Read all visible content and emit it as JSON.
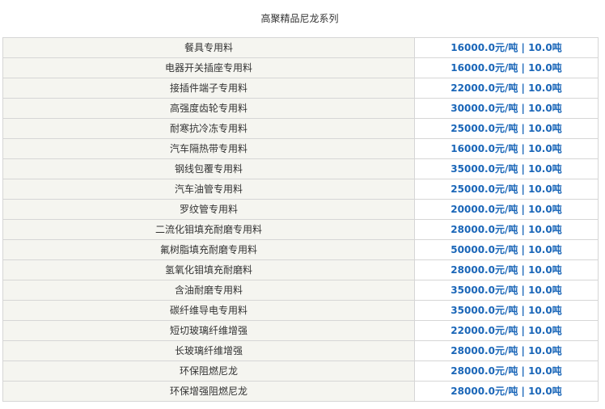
{
  "title": "高聚精品尼龙系列",
  "rows": [
    {
      "name": "餐具专用料",
      "price": "16000.0元/吨 | 10.0吨"
    },
    {
      "name": "电器开关插座专用料",
      "price": "16000.0元/吨 | 10.0吨"
    },
    {
      "name": "接插件端子专用料",
      "price": "22000.0元/吨 | 10.0吨"
    },
    {
      "name": "高强度齿轮专用料",
      "price": "30000.0元/吨 | 10.0吨"
    },
    {
      "name": "耐寒抗冷冻专用料",
      "price": "25000.0元/吨 | 10.0吨"
    },
    {
      "name": "汽车隔热带专用料",
      "price": "16000.0元/吨 | 10.0吨"
    },
    {
      "name": "钢线包覆专用料",
      "price": "35000.0元/吨 | 10.0吨"
    },
    {
      "name": "汽车油管专用料",
      "price": "25000.0元/吨 | 10.0吨"
    },
    {
      "name": "罗纹管专用料",
      "price": "20000.0元/吨 | 10.0吨"
    },
    {
      "name": "二流化钼填充耐磨专用料",
      "price": "28000.0元/吨 | 10.0吨"
    },
    {
      "name": "氟树脂填充耐磨专用料",
      "price": "50000.0元/吨 | 10.0吨"
    },
    {
      "name": "氢氧化钼填充耐磨料",
      "price": "28000.0元/吨 | 10.0吨"
    },
    {
      "name": "含油耐磨专用料",
      "price": "35000.0元/吨 | 10.0吨"
    },
    {
      "name": "碳纤维导电专用料",
      "price": "35000.0元/吨 | 10.0吨"
    },
    {
      "name": "短切玻璃纤维增强",
      "price": "22000.0元/吨 | 10.0吨"
    },
    {
      "name": "长玻璃纤维增强",
      "price": "28000.0元/吨 | 10.0吨"
    },
    {
      "name": "环保阻燃尼龙",
      "price": "28000.0元/吨 | 10.0吨"
    },
    {
      "name": "环保增强阻燃尼龙",
      "price": "28000.0元/吨 | 10.0吨"
    }
  ]
}
